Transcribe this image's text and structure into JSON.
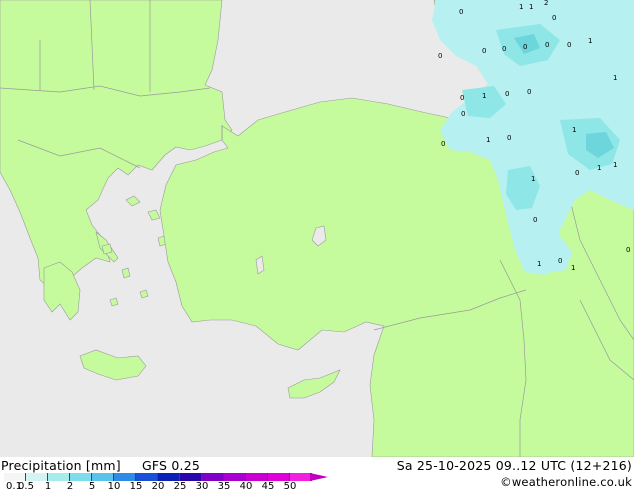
{
  "map": {
    "colors": {
      "land": "#c5fb9d",
      "sea": "#eaeaea",
      "border": "#9a9a9a",
      "precip_light": "#b6f0f0",
      "precip_mid": "#8ee6e6",
      "precip_heavy": "#6cd6dc"
    },
    "precip_values": [
      "0",
      "1",
      "2",
      "0",
      "1",
      "0",
      "0",
      "0",
      "0",
      "0",
      "0",
      "1",
      "1",
      "0",
      "1",
      "0",
      "0",
      "0",
      "0",
      "1",
      "0",
      "1",
      "0",
      "1",
      "1",
      "1",
      "0",
      "1",
      "0",
      "1",
      "0"
    ]
  },
  "legend": {
    "title": "Precipitation [mm]",
    "model": "GFS 0.25",
    "datetime": "Sa 25-10-2025 09..12 UTC (12+216)",
    "credit": "©weatheronline.co.uk",
    "scale_labels": [
      "0.1",
      "0.5",
      "1",
      "2",
      "5",
      "10",
      "15",
      "20",
      "25",
      "30",
      "35",
      "40",
      "45",
      "50"
    ],
    "scale_colors": [
      "#f5f5f5",
      "#d4f4f4",
      "#a6ecec",
      "#7fdcec",
      "#58c4ec",
      "#2e8ce8",
      "#1850d8",
      "#0c20b8",
      "#2808a8",
      "#8000c8",
      "#a800d0",
      "#c800d0",
      "#e000d8",
      "#f020e0"
    ]
  }
}
